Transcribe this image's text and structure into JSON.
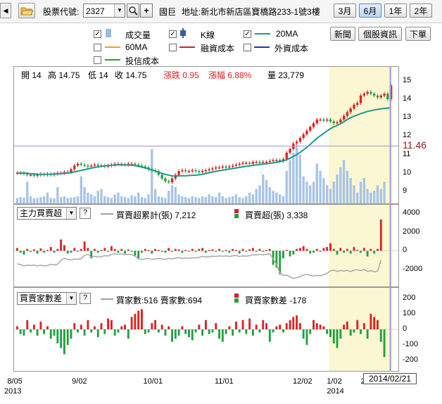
{
  "toolbar": {
    "stock_code_label": "股票代號:",
    "stock_code_value": "2327",
    "plus": "+",
    "company_name": "國巨",
    "address": "地址:新北市新店區寶橋路233-1號3樓",
    "range_buttons": [
      "3月",
      "6月",
      "1年",
      "2年"
    ],
    "active_range": "6月"
  },
  "legend": {
    "items": [
      {
        "label": "成交量",
        "checked": true,
        "color": "#9dbbe0"
      },
      {
        "label": "K線",
        "checked": true,
        "color": "#3b5aa0"
      },
      {
        "label": "20MA",
        "checked": true,
        "color": "#1a9b8c"
      },
      {
        "label": "60MA",
        "checked": false,
        "color": "#f0a020"
      },
      {
        "label": "融資成本",
        "checked": false,
        "color": "#d02020"
      },
      {
        "label": "外資成本",
        "checked": false,
        "color": "#2030c0"
      },
      {
        "label": "投信成本",
        "checked": false,
        "color": "#20a040"
      }
    ],
    "buttons": [
      "新聞",
      "個股資訊",
      "下單"
    ]
  },
  "price_info": {
    "open": "開 14",
    "high": "高 14.75",
    "low": "低 14",
    "close": "收 14.75",
    "change": "漲跌 0.95",
    "change_pct": "漲幅 6.88%",
    "volume": "量 23,779"
  },
  "price_axis": [
    "15",
    "14",
    "13",
    "12",
    "11",
    "10",
    "9"
  ],
  "crosshair_value": "11.46",
  "panel2": {
    "select": "主力買賣超",
    "legend_line": "買賣超累計(張) 7,212",
    "legend_bar": "買賣超(張) 3,338",
    "axis": [
      "4000",
      "2000",
      "0",
      "-2000"
    ]
  },
  "panel3": {
    "select": "買賣家數差",
    "legend_line": "買家數:516 賣家數:694",
    "legend_bar": "買賣家數差 -178",
    "axis": [
      "200",
      "100",
      "0",
      "-100",
      "-200"
    ]
  },
  "x_axis": {
    "ticks": [
      "8/05",
      "9/02",
      "10/01",
      "11/01",
      "12/02",
      "1/02",
      "2/05"
    ],
    "years": [
      "2013",
      "2014"
    ],
    "cursor_date": "2014/02/21"
  },
  "chart_data": {
    "type": "bar",
    "close_price": [
      10.0,
      10.0,
      9.95,
      9.9,
      9.9,
      9.85,
      9.9,
      9.95,
      9.9,
      9.95,
      9.9,
      9.95,
      10.0,
      10.0,
      10.05,
      10.05,
      10.2,
      10.4,
      10.5,
      10.45,
      10.4,
      10.35,
      10.4,
      10.45,
      10.4,
      10.4,
      10.35,
      10.4,
      10.45,
      10.5,
      10.5,
      10.45,
      10.45,
      10.5,
      10.5,
      10.45,
      10.4,
      10.35,
      10.3,
      10.2,
      10.15,
      10.1,
      9.9,
      9.7,
      9.55,
      9.5,
      9.7,
      9.9,
      10.1,
      10.15,
      10.1,
      10.1,
      10.15,
      10.1,
      10.05,
      10.1,
      10.15,
      10.2,
      10.25,
      10.3,
      10.3,
      10.35,
      10.3,
      10.35,
      10.4,
      10.45,
      10.5,
      10.55,
      10.55,
      10.5,
      10.6,
      10.6,
      10.55,
      10.6,
      10.6,
      10.65,
      10.7,
      10.7,
      10.65,
      10.75,
      11.1,
      11.3,
      11.6,
      11.7,
      11.9,
      12.1,
      12.3,
      12.5,
      12.7,
      12.9,
      12.9,
      12.85,
      12.9,
      12.8,
      12.7,
      12.75,
      12.9,
      13.1,
      13.3,
      13.5,
      13.7,
      13.8,
      14.2,
      14.3,
      14.4,
      14.3,
      14.2,
      14.1,
      14.2,
      14.3,
      14.0,
      14.75
    ],
    "ma20": [
      10.0,
      10.0,
      10.0,
      9.98,
      9.96,
      9.95,
      9.93,
      9.92,
      9.92,
      9.93,
      9.93,
      9.94,
      9.95,
      9.96,
      9.98,
      10.0,
      10.02,
      10.06,
      10.1,
      10.14,
      10.18,
      10.22,
      10.26,
      10.3,
      10.33,
      10.36,
      10.38,
      10.4,
      10.42,
      10.43,
      10.44,
      10.44,
      10.44,
      10.43,
      10.42,
      10.4,
      10.36,
      10.32,
      10.28,
      10.22,
      10.16,
      10.1,
      10.04,
      9.98,
      9.92,
      9.88,
      9.85,
      9.84,
      9.84,
      9.85,
      9.85,
      9.86,
      9.87,
      9.88,
      9.9,
      9.93,
      9.97,
      10.01,
      10.05,
      10.09,
      10.12,
      10.15,
      10.18,
      10.21,
      10.24,
      10.27,
      10.3,
      10.33,
      10.36,
      10.38,
      10.41,
      10.44,
      10.46,
      10.48,
      10.5,
      10.52,
      10.55,
      10.58,
      10.62,
      10.66,
      10.72,
      10.8,
      10.9,
      11.0,
      11.12,
      11.25,
      11.4,
      11.55,
      11.72,
      11.88,
      12.02,
      12.15,
      12.28,
      12.4,
      12.5,
      12.58,
      12.68,
      12.78,
      12.9,
      13.0,
      13.08,
      13.15,
      13.22,
      13.28,
      13.34,
      13.38,
      13.42,
      13.45,
      13.48,
      13.5,
      13.52,
      13.55
    ],
    "volume": [
      300,
      350,
      320,
      1200,
      400,
      280,
      300,
      350,
      400,
      600,
      300,
      280,
      900,
      350,
      400,
      300,
      320,
      350,
      400,
      1500,
      900,
      600,
      500,
      400,
      700,
      800,
      400,
      350,
      300,
      500,
      600,
      400,
      350,
      300,
      450,
      400,
      600,
      350,
      300,
      500,
      3000,
      800,
      400,
      350,
      300,
      700,
      1000,
      900,
      500,
      400,
      350,
      300,
      400,
      350,
      300,
      400,
      350,
      500,
      400,
      350,
      600,
      400,
      300,
      350,
      400,
      500,
      350,
      300,
      400,
      600,
      500,
      800,
      1000,
      1600,
      1300,
      900,
      700,
      600,
      500,
      400,
      1800,
      2400,
      2800,
      3200,
      2700,
      1500,
      1200,
      1000,
      1200,
      2200,
      1800,
      1400,
      1000,
      800,
      1200,
      1600,
      2000,
      2400,
      1800,
      1400,
      1000,
      600,
      1200,
      1400,
      800,
      600,
      700,
      1000,
      800,
      1200
    ],
    "net_buy": [
      300,
      -200,
      -400,
      200,
      -100,
      150,
      -300,
      250,
      -200,
      100,
      400,
      -200,
      200,
      1200,
      600,
      -300,
      -200,
      300,
      -100,
      200,
      1000,
      300,
      -800,
      200,
      -200,
      100,
      300,
      -100,
      500,
      200,
      -200,
      200,
      -300,
      150,
      -100,
      -500,
      -800,
      -200,
      200,
      100,
      -300,
      200,
      100,
      -100,
      -200,
      300,
      -100,
      200,
      150,
      -200,
      100,
      -100,
      200,
      -100,
      200,
      300,
      -200,
      100,
      150,
      -100,
      200,
      -100,
      100,
      -200,
      200,
      100,
      -300,
      200,
      -100,
      150,
      300,
      -100,
      200,
      -100,
      100,
      200,
      -1500,
      -1800,
      -2500,
      -800,
      100,
      -600,
      -400,
      200,
      300,
      500,
      200,
      -300,
      -200,
      200,
      -100,
      300,
      400,
      800,
      200,
      -400,
      300,
      -200,
      200,
      -300,
      400,
      100,
      -200,
      300,
      -600,
      200,
      -300,
      200,
      3338
    ],
    "buyer_diff": [
      20,
      -30,
      -40,
      60,
      -20,
      30,
      -40,
      50,
      -30,
      20,
      -60,
      -40,
      -90,
      -120,
      -160,
      -100,
      -60,
      40,
      -20,
      30,
      -40,
      60,
      -20,
      20,
      -50,
      40,
      -30,
      70,
      60,
      -40,
      -20,
      20,
      30,
      -60,
      80,
      100,
      120,
      130,
      -30,
      -20,
      40,
      60,
      -20,
      30,
      -40,
      20,
      -80,
      -60,
      -40,
      20,
      -30,
      -50,
      -70,
      -20,
      30,
      -40,
      60,
      -30,
      -20,
      40,
      -60,
      -80,
      -30,
      20,
      -40,
      50,
      -20,
      60,
      -30,
      70,
      -40,
      30,
      -20,
      60,
      40,
      -80,
      -20,
      20,
      30,
      -20,
      40,
      60,
      80,
      90,
      40,
      -60,
      -100,
      -30,
      60,
      40,
      30,
      20,
      -30,
      -50,
      -90,
      -120,
      -60,
      30,
      50,
      -40,
      -20,
      60,
      -30,
      40,
      -60,
      100,
      80,
      60,
      -80,
      -178
    ]
  }
}
